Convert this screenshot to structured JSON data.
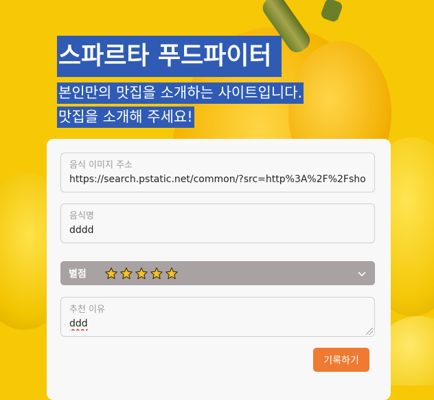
{
  "header": {
    "title": "스파르타 푸드파이터",
    "subtitle_line1": "본인만의 맛집을 소개하는 사이트입니다.",
    "subtitle_line2": "맛집을 소개해 주세요!"
  },
  "form": {
    "image_url": {
      "label": "음식 이미지 주소",
      "value": "https://search.pstatic.net/common/?src=http%3A%2F%2Fsho"
    },
    "food_name": {
      "label": "음식명",
      "value": "dddd"
    },
    "rating": {
      "label": "별점",
      "selected_value": "⭐⭐⭐⭐⭐",
      "stars": 5
    },
    "reason": {
      "label": "추천 이유",
      "value": "ddd"
    },
    "submit_label": "기록하기"
  },
  "colors": {
    "title_bg": "#2f5bb5",
    "button": "#ef7a31",
    "rating_bg": "#a8a2a2",
    "background": "#f7c805"
  },
  "icons": {
    "star": "star-icon",
    "dropdown": "chevron-down-icon"
  }
}
